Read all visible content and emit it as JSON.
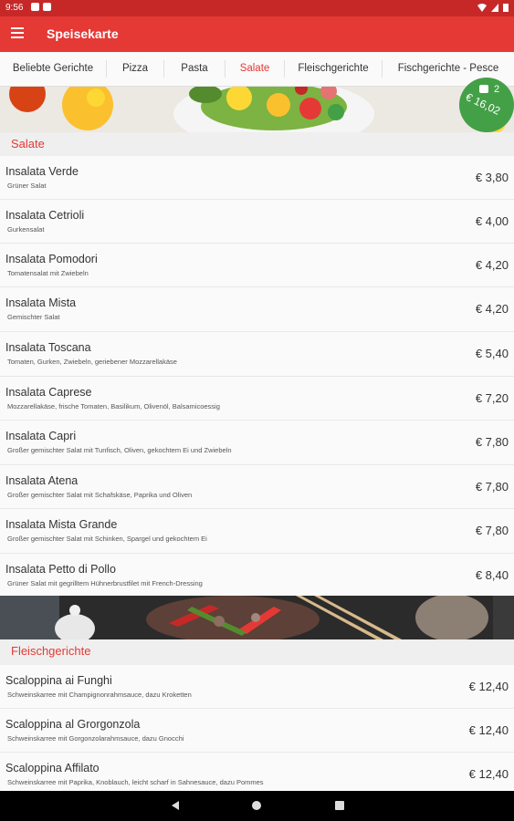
{
  "status": {
    "time": "9:56"
  },
  "appbar": {
    "title": "Speisekarte"
  },
  "tabs": [
    {
      "label": "Beliebte Gerichte"
    },
    {
      "label": "Pizza"
    },
    {
      "label": "Pasta"
    },
    {
      "label": "Salate",
      "active": true
    },
    {
      "label": "Fleischgerichte"
    },
    {
      "label": "Fischgerichte - Pesce"
    }
  ],
  "cart": {
    "count": "2",
    "total": "€ 16,02"
  },
  "sections": [
    {
      "title": "Salate",
      "items": [
        {
          "name": "Insalata Verde",
          "desc": "Grüner Salat",
          "price": "€ 3,80"
        },
        {
          "name": "Insalata Cetrioli",
          "desc": "Gurkensalat",
          "price": "€ 4,00"
        },
        {
          "name": "Insalata Pomodori",
          "desc": "Tomatensalat mit Zwiebeln",
          "price": "€ 4,20"
        },
        {
          "name": "Insalata Mista",
          "desc": "Gemischter Salat",
          "price": "€ 4,20"
        },
        {
          "name": "Insalata Toscana",
          "desc": "Tomaten, Gurken, Zwiebeln, geriebener Mozzarellakäse",
          "price": "€ 5,40"
        },
        {
          "name": "Insalata Caprese",
          "desc": "Mozzarellakäse, frische Tomaten, Basilikum, Olivenöl, Balsamicoessig",
          "price": "€ 7,20"
        },
        {
          "name": "Insalata Capri",
          "desc": "Großer gemischter Salat mit Tunfisch, Oliven, gekochtem Ei und Zwiebeln",
          "price": "€ 7,80"
        },
        {
          "name": "Insalata Atena",
          "desc": "Großer gemischter Salat mit Schafskäse, Paprika und Oliven",
          "price": "€ 7,80"
        },
        {
          "name": "Insalata Mista Grande",
          "desc": "Großer gemischter Salat mit Schinken, Spargel und gekochtem Ei",
          "price": "€ 7,80"
        },
        {
          "name": "Insalata Petto di Pollo",
          "desc": "Grüner Salat mit gegrilltem Hühnerbrustfilet mit French-Dressing",
          "price": "€ 8,40"
        }
      ]
    },
    {
      "title": "Fleischgerichte",
      "items": [
        {
          "name": "Scaloppina ai Funghi",
          "desc": "Schweinskarree mit Champignonrahmsauce, dazu Kroketten",
          "price": "€ 12,40"
        },
        {
          "name": "Scaloppina al Grorgonzola",
          "desc": "Schweinskarree mit Gorgonzolarahmsauce, dazu Gnocchi",
          "price": "€ 12,40"
        },
        {
          "name": "Scaloppina Affilato",
          "desc": "Schweinskarree mit Paprika, Knoblauch, leicht scharf in Sahnesauce, dazu Pommes",
          "price": "€ 12,40"
        }
      ]
    }
  ],
  "colors": {
    "primary": "#e53935",
    "statusbar": "#c62828",
    "cart": "#43a047"
  }
}
